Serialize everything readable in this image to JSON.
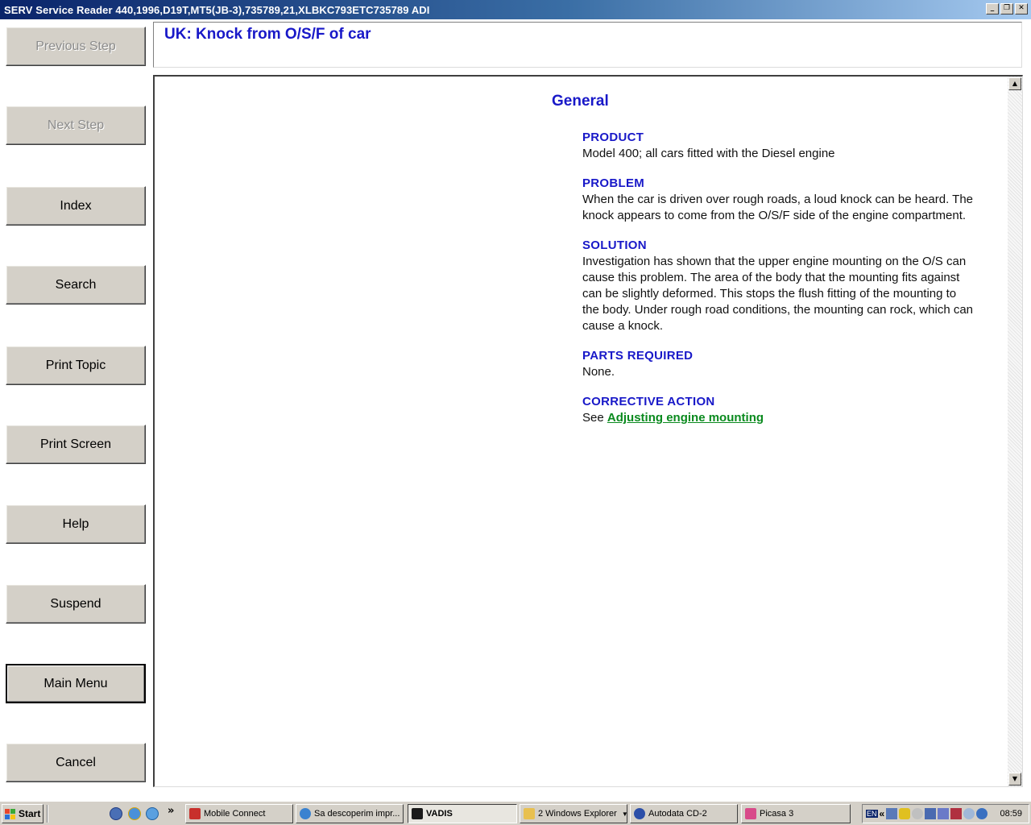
{
  "window": {
    "title": "SERV Service Reader 440,1996,D19T,MT5(JB-3),735789,21,XLBKC793ETC735789 ADI",
    "minimize_glyph": "_",
    "restore_glyph": "❐",
    "close_glyph": "✕"
  },
  "nav": {
    "previous_step": "Previous Step",
    "next_step": "Next Step",
    "index": "Index",
    "search": "Search",
    "print_topic": "Print Topic",
    "print_screen": "Print Screen",
    "help": "Help",
    "suspend": "Suspend",
    "main_menu": "Main Menu",
    "cancel": "Cancel"
  },
  "header": {
    "title": "UK: Knock from O/S/F of car"
  },
  "document": {
    "heading": "General",
    "sections": [
      {
        "heading": "PRODUCT",
        "body": "Model 400; all cars fitted with the Diesel engine"
      },
      {
        "heading": "PROBLEM",
        "body_lines": [
          "When the car is driven over rough roads, a loud knock can be heard. The",
          "knock appears to come from the O/S/F side of the engine compartment."
        ]
      },
      {
        "heading": "SOLUTION",
        "body_lines": [
          "Investigation has shown that the upper engine mounting on the O/S can",
          "cause this problem. The area of the body that the mounting fits against",
          "can be slightly deformed. This stops the flush fitting of the mounting to",
          "the body. Under rough road conditions, the mounting can rock, which can",
          "cause a knock."
        ]
      },
      {
        "heading": "PARTS REQUIRED",
        "body": "None."
      },
      {
        "heading": "CORRECTIVE ACTION",
        "prefix": "See",
        "link": "Adjusting engine mounting"
      }
    ]
  },
  "scrollbar": {
    "up_glyph": "▲",
    "down_glyph": "▼"
  },
  "taskbar": {
    "start": "Start",
    "overflow": "»",
    "tasks": [
      {
        "label": "Mobile Connect",
        "icon": "mobile-connect-icon"
      },
      {
        "label": "Sa descoperim impr...",
        "icon": "internet-explorer-icon"
      },
      {
        "label": "VADIS",
        "icon": "vadis-icon"
      },
      {
        "label": "2 Windows Explorer",
        "icon": "folder-icon"
      },
      {
        "label": "Autodata CD-2",
        "icon": "autodata-icon"
      },
      {
        "label": "Picasa 3",
        "icon": "picasa-icon"
      }
    ],
    "tray": {
      "language": "EN",
      "chevron": "«",
      "clock": "08:59"
    }
  },
  "colors": {
    "heading_blue": "#1818c8",
    "link_green": "#0a8a1e",
    "button_face": "#d4d0c8"
  }
}
